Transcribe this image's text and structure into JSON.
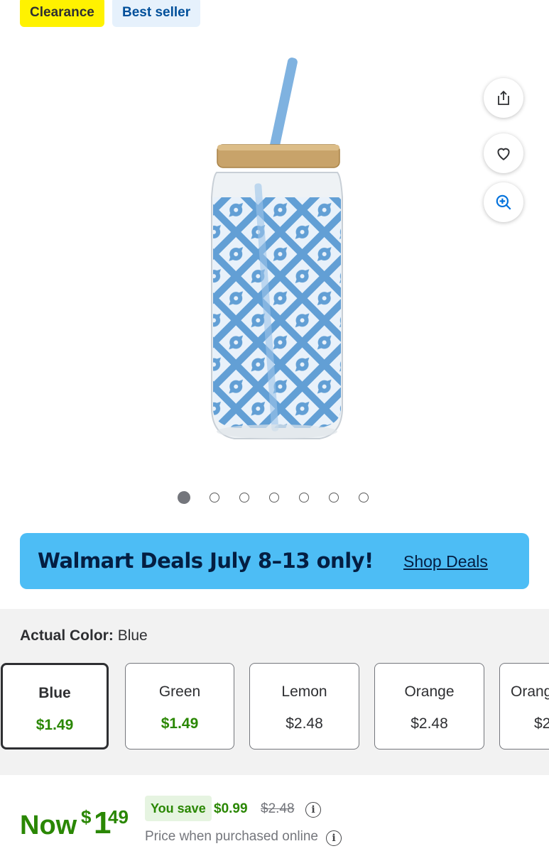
{
  "badges": {
    "clearance": "Clearance",
    "best_seller": "Best seller"
  },
  "actions": {
    "share_icon": "share-icon",
    "favorite_icon": "heart-icon",
    "zoom_icon": "zoom-in-icon"
  },
  "carousel": {
    "count": 7,
    "active_index": 1
  },
  "deals_banner": {
    "text": "Walmart Deals July 8–13 only!",
    "link": "Shop Deals"
  },
  "variant": {
    "label": "Actual Color:",
    "selected_value": "Blue",
    "options": [
      {
        "name": "Blue",
        "price": "$1.49"
      },
      {
        "name": "Green",
        "price": "$1.49"
      },
      {
        "name": "Lemon",
        "price": "$2.48"
      },
      {
        "name": "Orange",
        "price": "$2.48"
      },
      {
        "name": "Orang",
        "price": "$2"
      }
    ]
  },
  "price": {
    "now_label": "Now",
    "currency": "$",
    "dollars": "1",
    "cents": "49",
    "you_save_label": "You save",
    "save_amount": "$0.99",
    "was_price": "$2.48",
    "note": "Price when purchased online"
  },
  "colors": {
    "green": "#2a8703",
    "banner": "#4dbdf5",
    "navy": "#041e42",
    "clearance": "#fff200"
  }
}
